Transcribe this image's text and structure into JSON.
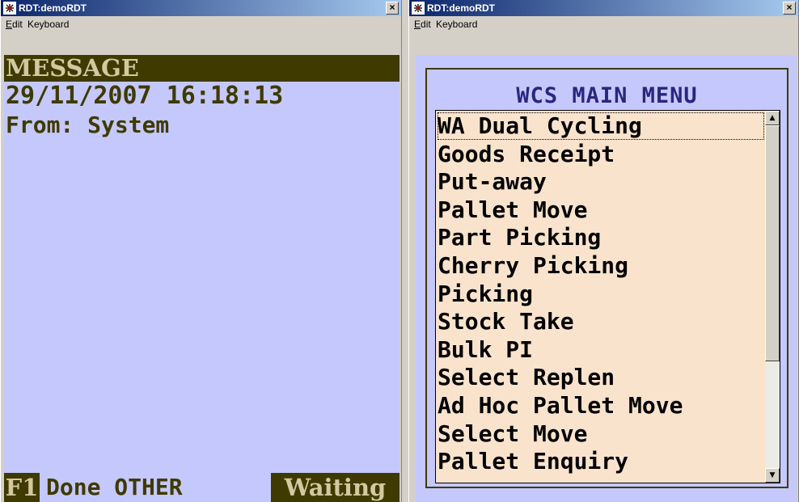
{
  "left_window": {
    "title": "RDT:demoRDT",
    "close_label": "×",
    "menu": [
      {
        "label": "Edit",
        "mnemonic": "E",
        "rest": "dit"
      },
      {
        "label": "Keyboard",
        "mnemonic": "",
        "rest": "Keyboard"
      }
    ],
    "screen": {
      "header": "MESSAGE",
      "datetime": "29/11/2007 16:18:13",
      "from": "From: System",
      "footer_key": "F1",
      "footer_text": "Done OTHER",
      "footer_status": "Waiting"
    }
  },
  "right_window": {
    "title": "RDT:demoRDT",
    "close_label": "×",
    "menu": [
      {
        "label": "Edit",
        "mnemonic": "E",
        "rest": "dit"
      },
      {
        "label": "Keyboard",
        "mnemonic": "",
        "rest": "Keyboard"
      }
    ],
    "screen": {
      "menu_title": "WCS MAIN MENU",
      "items": [
        "WA Dual Cycling",
        "Goods Receipt",
        "Put-away",
        "Pallet Move",
        "Part Picking",
        "Cherry Picking",
        "Picking",
        "Stock Take",
        "Bulk PI",
        "Select Replen",
        "Ad Hoc Pallet Move",
        "Select Move",
        "Pallet Enquiry"
      ],
      "selected_index": 0
    }
  },
  "colors": {
    "screen_bg": "#c5c8fc",
    "terminal_text": "#3e3a00",
    "list_bg": "#f9e3cc",
    "title_text": "#2a2680"
  },
  "icons": [
    "app-icon",
    "close-icon",
    "scroll-up-icon",
    "scroll-down-icon"
  ]
}
